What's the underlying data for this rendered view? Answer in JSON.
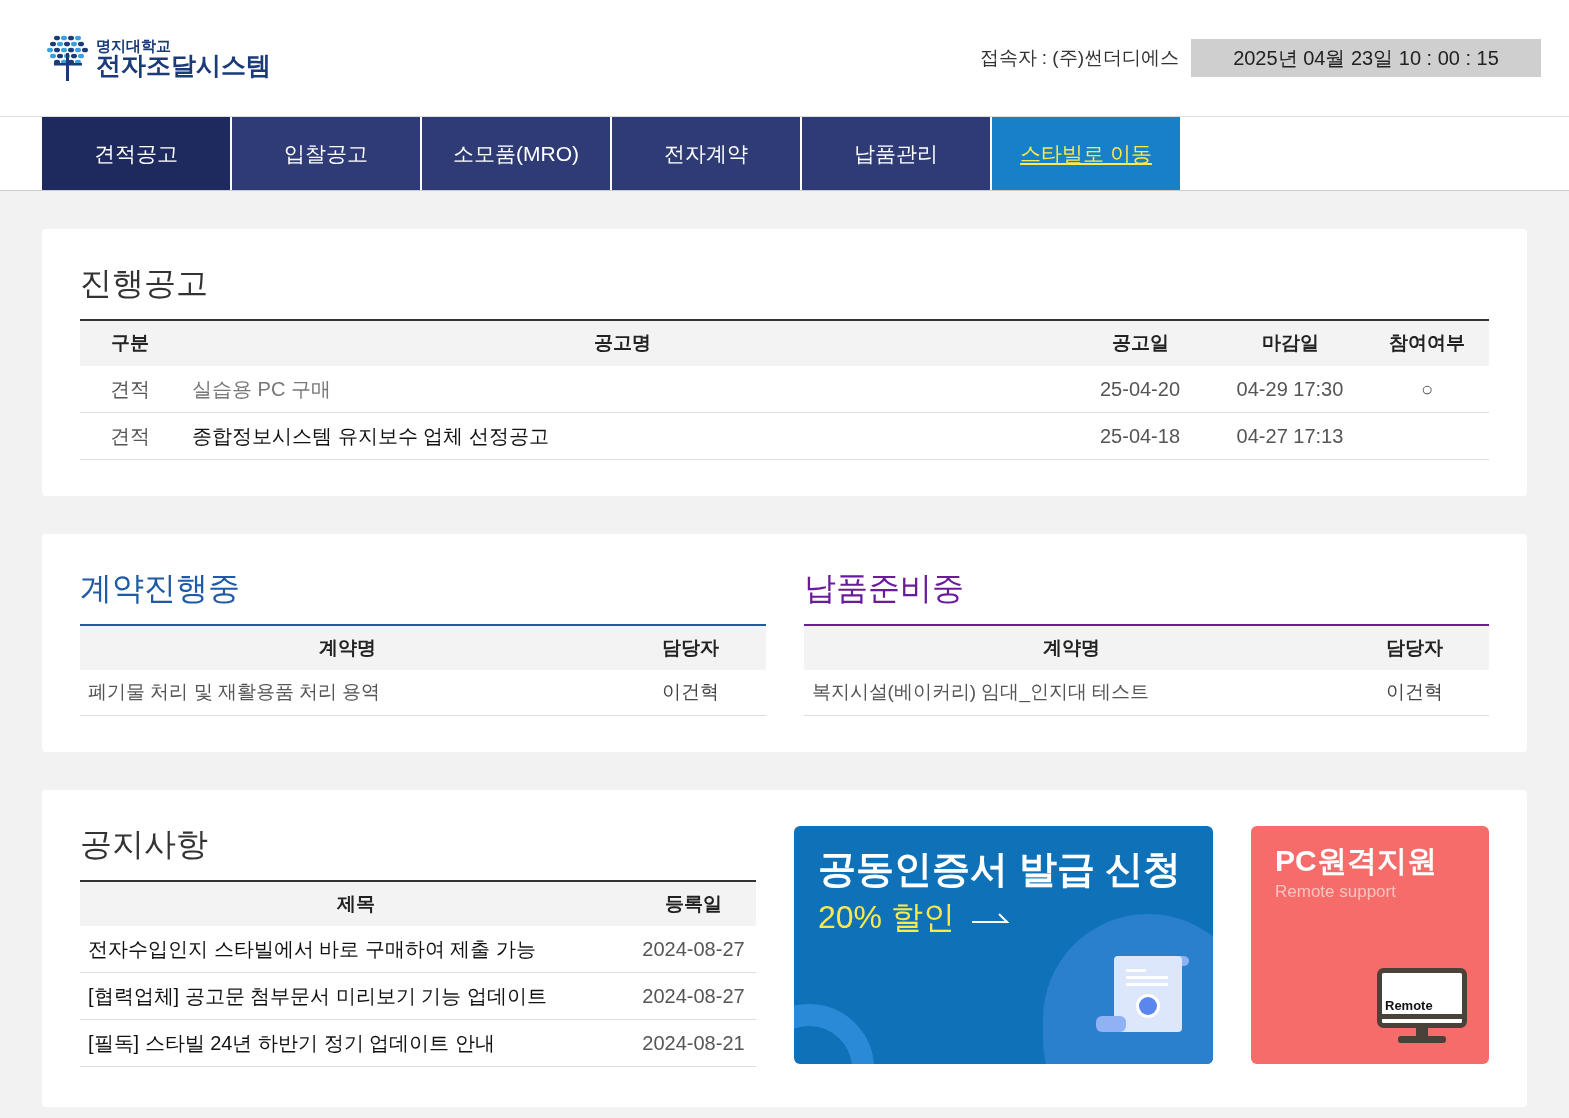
{
  "header": {
    "logo_top": "명지대학교",
    "logo_bottom": "전자조달시스템",
    "user_label": "접속자 : (주)썬더디에스",
    "datetime": "2025년 04월 23일 10 : 00 : 15"
  },
  "nav": [
    {
      "label": "견적공고",
      "kind": "menu",
      "selected": true
    },
    {
      "label": "입찰공고",
      "kind": "menu",
      "selected": false
    },
    {
      "label": "소모품(MRO)",
      "kind": "menu",
      "selected": false
    },
    {
      "label": "전자계약",
      "kind": "menu",
      "selected": false
    },
    {
      "label": "납품관리",
      "kind": "menu",
      "selected": false
    },
    {
      "label": "스타빌로 이동",
      "kind": "link",
      "selected": false
    }
  ],
  "notices_in_progress": {
    "title": "진행공고",
    "columns": [
      "구분",
      "공고명",
      "공고일",
      "마감일",
      "참여여부"
    ],
    "rows": [
      {
        "type": "견적",
        "name": "실습용 PC 구매",
        "visited": true,
        "date": "25-04-20",
        "deadline": "04-29 17:30",
        "participation": "○"
      },
      {
        "type": "견적",
        "name": "종합정보시스템 유지보수 업체 선정공고",
        "visited": false,
        "date": "25-04-18",
        "deadline": "04-27 17:13"
      }
    ]
  },
  "contracts": {
    "title": "계약진행중",
    "color": "#1f5aa6",
    "columns": [
      "계약명",
      "담당자"
    ],
    "rows": [
      {
        "name": "폐기물 처리 및 재활용품 처리 용역",
        "manager": "이건혁"
      }
    ]
  },
  "deliveries": {
    "title": "납품준비중",
    "color": "#6a1b9a",
    "columns": [
      "계약명",
      "담당자"
    ],
    "rows": [
      {
        "name": "복지시설(베이커리) 임대_인지대 테스트",
        "manager": "이건혁"
      }
    ]
  },
  "announcements": {
    "title": "공지사항",
    "columns": [
      "제목",
      "등록일"
    ],
    "rows": [
      {
        "title": "전자수입인지 스타빌에서 바로 구매하여 제출 가능",
        "date": "2024-08-27"
      },
      {
        "title": "[협력업체] 공고문 첨부문서 미리보기 기능 업데이트",
        "date": "2024-08-27"
      },
      {
        "title": "[필독] 스타빌 24년 하반기 정기 업데이트 안내",
        "date": "2024-08-21"
      }
    ]
  },
  "banners": {
    "certificate": {
      "title": "공동인증서 발급 신청",
      "subtitle": "20% 할인"
    },
    "remote": {
      "title": "PC원격지원",
      "subtitle": "Remote support",
      "screen_label": "Remote"
    }
  }
}
